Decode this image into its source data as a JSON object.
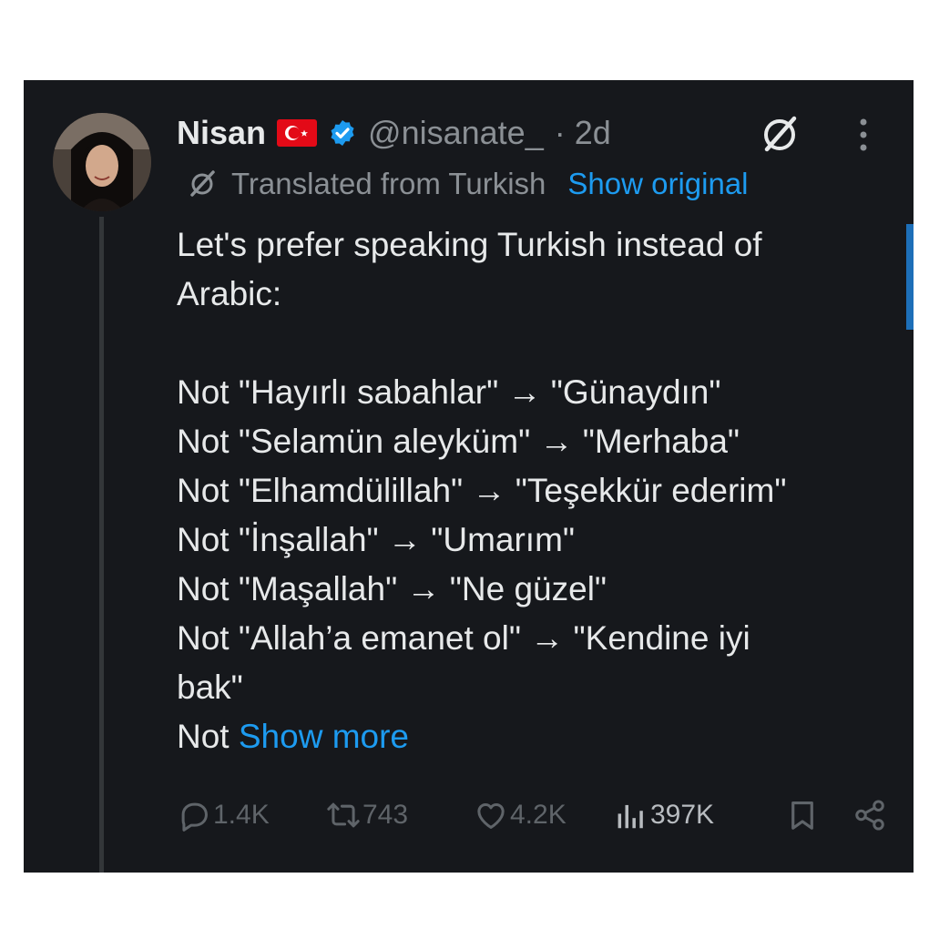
{
  "post": {
    "author_name": "Nisan",
    "handle": "@nisanate_",
    "time": "· 2d",
    "translated_label": "Translated from Turkish",
    "show_original": "Show original",
    "lines": [
      "Let's prefer speaking Turkish instead of",
      "Arabic:",
      "",
      "Not \"Hayırlı sabahlar\" → \"Günaydın\"",
      "Not \"Selamün aleyküm\" → \"Merhaba\"",
      "Not \"Elhamdülillah\" → \"Teşekkür ederim\"",
      "Not \"İnşallah\" → \"Umarım\"",
      "Not \"Maşallah\" → \"Ne güzel\"",
      "Not \"Allah’a emanet ol\" → \"Kendine iyi",
      "bak\""
    ],
    "last_line_prefix": "Not ",
    "show_more": "Show more"
  },
  "actions": {
    "replies": "1.4K",
    "reposts": "743",
    "likes": "4.2K",
    "views": "397K"
  },
  "icons": {
    "flag": "turkey-flag-icon",
    "verified": "verified-badge-icon",
    "grok": "grok-icon",
    "more": "more-vertical-icon",
    "reply": "reply-icon",
    "repost": "repost-icon",
    "like": "like-icon",
    "views": "views-icon",
    "bookmark": "bookmark-icon",
    "share": "share-icon"
  },
  "colors": {
    "background": "#16181c",
    "text": "#e7e9ea",
    "muted": "#8b9095",
    "accent": "#1d9bf0",
    "flag_red": "#e30a17",
    "verified_blue": "#1d9bf0"
  }
}
